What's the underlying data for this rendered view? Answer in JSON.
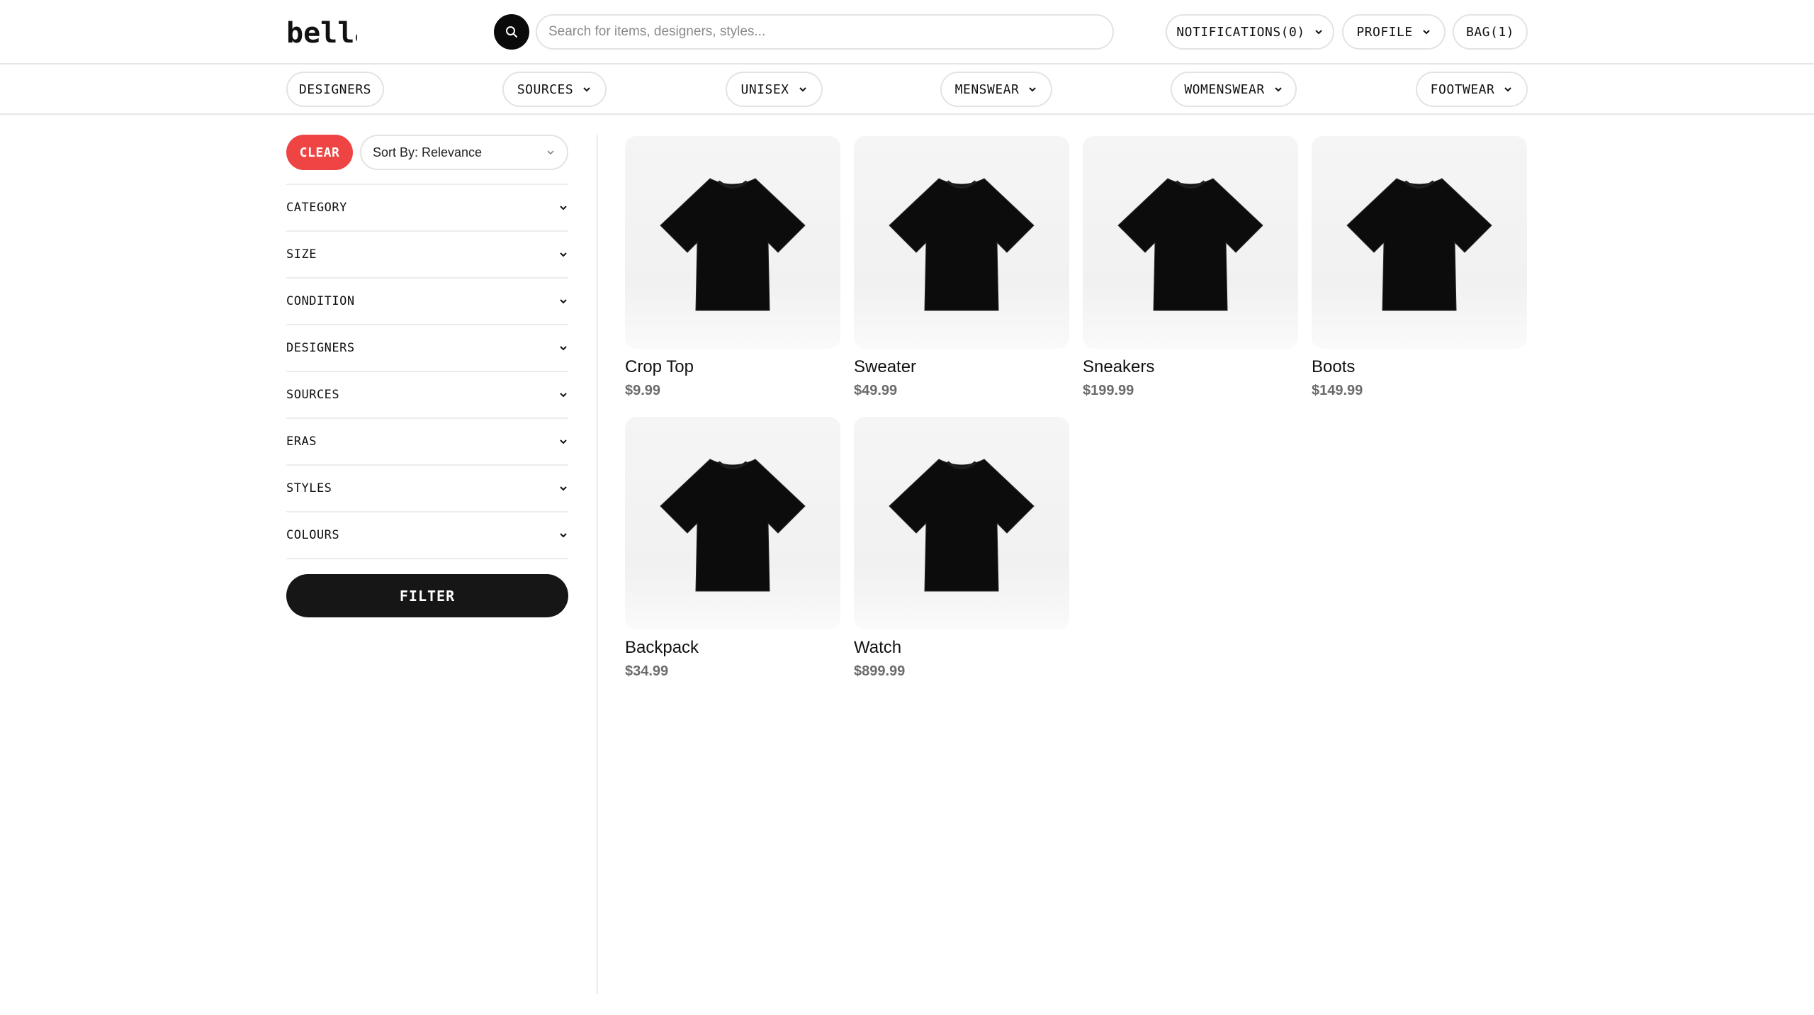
{
  "brand": {
    "logo_text": "bella"
  },
  "search": {
    "placeholder": "Search for items, designers, styles..."
  },
  "header_nav": {
    "notifications": "NOTIFICATIONS(0)",
    "profile": "PROFILE",
    "bag": "BAG(1)"
  },
  "categories": [
    {
      "label": "DESIGNERS",
      "has_dropdown": false
    },
    {
      "label": "SOURCES",
      "has_dropdown": true
    },
    {
      "label": "UNISEX",
      "has_dropdown": true
    },
    {
      "label": "MENSWEAR",
      "has_dropdown": true
    },
    {
      "label": "WOMENSWEAR",
      "has_dropdown": true
    },
    {
      "label": "FOOTWEAR",
      "has_dropdown": true
    }
  ],
  "sidebar": {
    "clear_label": "CLEAR",
    "sort_label": "Sort By: Relevance",
    "filters": [
      "CATEGORY",
      "SIZE",
      "CONDITION",
      "DESIGNERS",
      "SOURCES",
      "ERAS",
      "STYLES",
      "COLOURS"
    ],
    "filter_button": "FILTER"
  },
  "products": [
    {
      "name": "Crop Top",
      "price": "$9.99",
      "icon": "tshirt-image"
    },
    {
      "name": "Sweater",
      "price": "$49.99",
      "icon": "tshirt-image"
    },
    {
      "name": "Sneakers",
      "price": "$199.99",
      "icon": "tshirt-image"
    },
    {
      "name": "Boots",
      "price": "$149.99",
      "icon": "tshirt-image"
    },
    {
      "name": "Backpack",
      "price": "$34.99",
      "icon": "tshirt-image"
    },
    {
      "name": "Watch",
      "price": "$899.99",
      "icon": "tshirt-image"
    }
  ],
  "colors": {
    "clear_button": "#ef4444",
    "primary_dark": "#161616",
    "border": "#e3e3e3",
    "price_text": "#6b6b6b"
  }
}
